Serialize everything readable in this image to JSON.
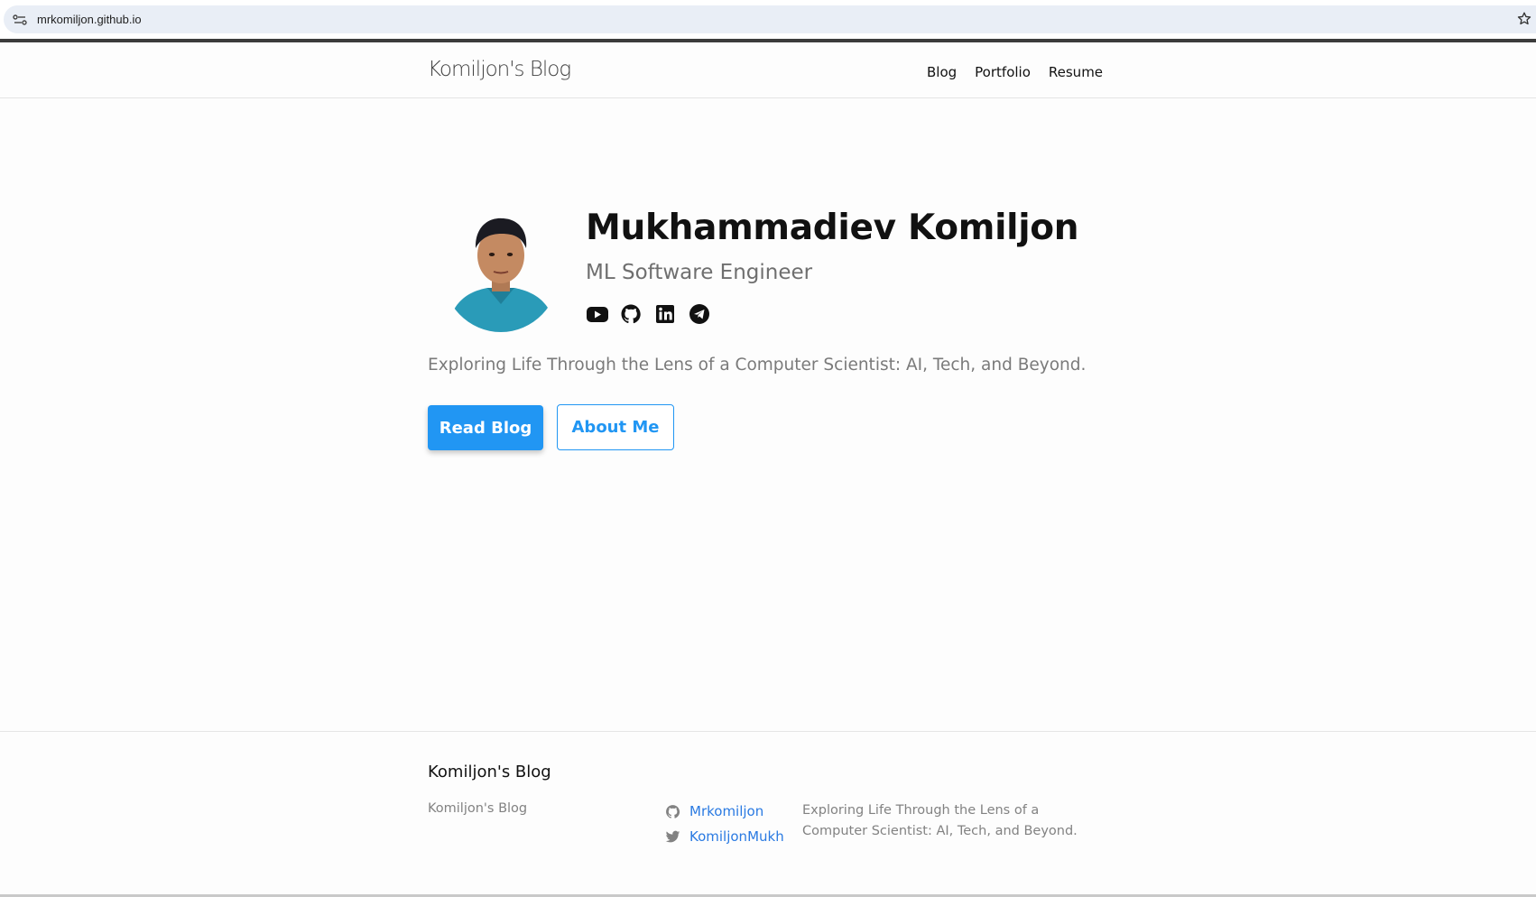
{
  "browser": {
    "url": "mrkomiljon.github.io"
  },
  "header": {
    "site_title": "Komiljon's Blog",
    "nav": [
      {
        "label": "Blog"
      },
      {
        "label": "Portfolio"
      },
      {
        "label": "Resume"
      }
    ]
  },
  "hero": {
    "name": "Mukhammadiev Komiljon",
    "role": "ML Software Engineer",
    "social_icons": [
      "youtube-icon",
      "github-icon",
      "linkedin-icon",
      "telegram-icon"
    ],
    "tagline": "Exploring Life Through the Lens of a Computer Scientist: AI, Tech, and Beyond.",
    "primary_button": "Read Blog",
    "secondary_button": "About Me"
  },
  "footer": {
    "heading": "Komiljon's Blog",
    "subtitle": "Komiljon's Blog",
    "links": [
      {
        "icon": "github-icon",
        "label": "Mrkomiljon"
      },
      {
        "icon": "twitter-icon",
        "label": "KomiljonMukh"
      }
    ],
    "description": "Exploring Life Through the Lens of a Computer Scientist: AI, Tech, and Beyond."
  },
  "colors": {
    "accent": "#2196f3",
    "link": "#2a7ae2",
    "muted_text": "#828282"
  }
}
